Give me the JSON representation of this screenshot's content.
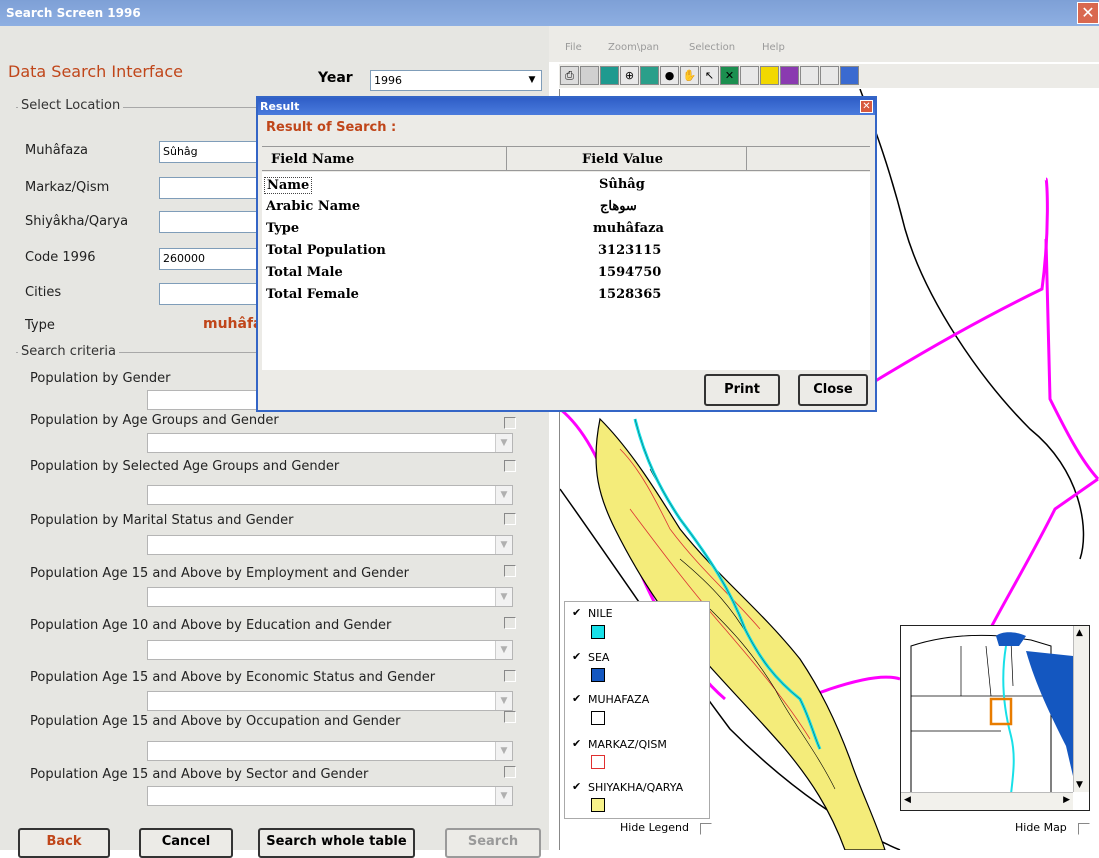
{
  "window": {
    "title": "Search Screen 1996",
    "close_glyph": "✕"
  },
  "menu": [
    "File",
    "Zoom\\pan",
    "Selection",
    "Help"
  ],
  "left": {
    "heading": "Data Search Interface",
    "year_label": "Year",
    "year_value": "1996",
    "select_location": "Select Location",
    "fields": [
      {
        "label": "Muhâfaza",
        "value": "Sûhâg"
      },
      {
        "label": "Markaz/Qism",
        "value": ""
      },
      {
        "label": "Shiyâkha/Qarya",
        "value": ""
      },
      {
        "label": "Code 1996",
        "value": "260000"
      },
      {
        "label": "Cities",
        "value": ""
      }
    ],
    "type_label": "Type",
    "type_value": "muhâfa",
    "search_criteria": "Search criteria",
    "criteria": [
      "Population by Gender",
      "Population by Age Groups and Gender",
      "Population by Selected Age Groups and Gender",
      "Population by Marital Status and Gender",
      "Population Age 15 and Above by Employment and Gender",
      "Population Age 10 and Above by Education and Gender",
      "Population Age 15 and Above by Economic Status and Gender",
      "Population Age 15 and Above by Occupation and Gender",
      "Population Age 15 and Above by Sector and Gender"
    ],
    "buttons": {
      "back": "Back",
      "cancel": "Cancel",
      "search_whole": "Search whole table",
      "search": "Search"
    }
  },
  "dialog": {
    "title": "Result",
    "close_glyph": "✕",
    "heading": "Result of Search :",
    "col_name": "Field Name",
    "col_value": "Field Value",
    "rows": [
      {
        "name": "Name",
        "value": "Sûhâg"
      },
      {
        "name": "Arabic Name",
        "value": "سوهاج"
      },
      {
        "name": "Type",
        "value": "muhâfaza"
      },
      {
        "name": "Total Population",
        "value": "3123115"
      },
      {
        "name": "Total Male",
        "value": "1594750"
      },
      {
        "name": "Total Female",
        "value": "1528365"
      }
    ],
    "print": "Print",
    "close": "Close"
  },
  "legend": {
    "items": [
      {
        "label": "NILE",
        "color": "#18e0e8"
      },
      {
        "label": "SEA",
        "color": "#1457c0"
      },
      {
        "label": "MUHAFAZA",
        "color": "#ffffff"
      },
      {
        "label": "MARKAZ/QISM",
        "color": "#ffffff"
      },
      {
        "label": "SHIYAKHA/QARYA",
        "color": "#f7f28a"
      }
    ],
    "hide_legend": "Hide Legend",
    "hide_map": "Hide Map",
    "check_glyph": "✔"
  },
  "colors": {
    "accent": "#c0461a",
    "boundary": "#ff00ff",
    "highlight": "#e87c00"
  }
}
